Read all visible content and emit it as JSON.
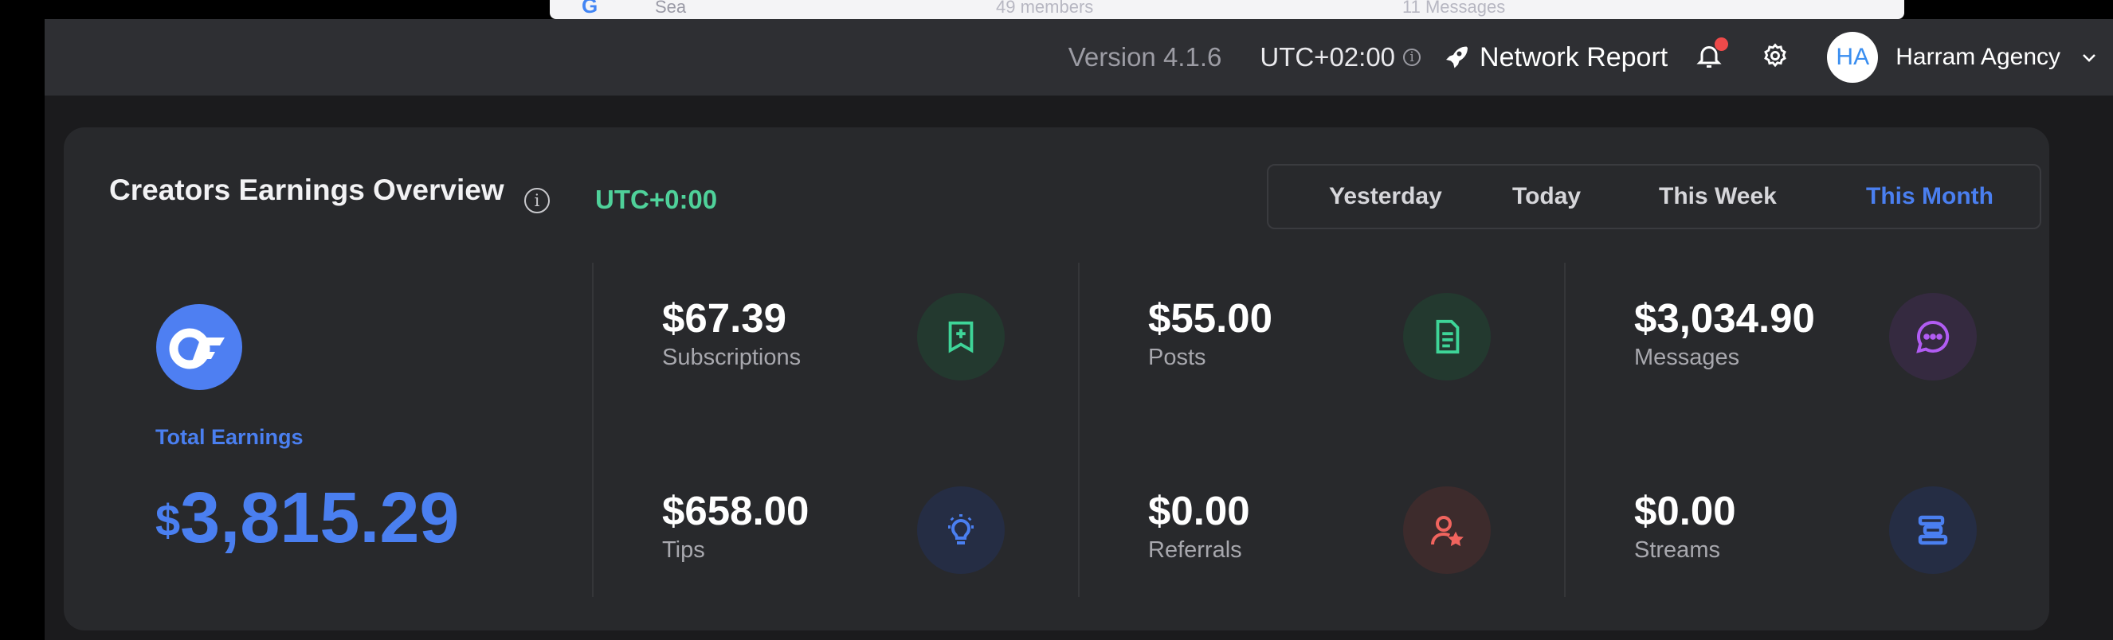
{
  "background_peek": {
    "search_text": "Sea",
    "members_text": "49 members",
    "messages_text": "11 Messages"
  },
  "header": {
    "version": "Version 4.1.6",
    "timezone": "UTC+02:00",
    "network_report": "Network Report",
    "avatar_initials": "HA",
    "agency_name": "Harram Agency"
  },
  "overview": {
    "title": "Creators Earnings Overview",
    "timezone": "UTC+0:00",
    "periods": [
      "Yesterday",
      "Today",
      "This Week",
      "This Month"
    ],
    "active_period": "This Month",
    "total_label": "Total Earnings",
    "total_currency": "$",
    "total_amount": "3,815.29",
    "stats": {
      "subscriptions": {
        "value": "$67.39",
        "label": "Subscriptions",
        "icon": "bookmark-plus-icon",
        "color": "#3ed598"
      },
      "posts": {
        "value": "$55.00",
        "label": "Posts",
        "icon": "document-icon",
        "color": "#3ed598"
      },
      "messages": {
        "value": "$3,034.90",
        "label": "Messages",
        "icon": "chat-bubble-icon",
        "color": "#b15cf3"
      },
      "tips": {
        "value": "$658.00",
        "label": "Tips",
        "icon": "lightbulb-icon",
        "color": "#4a7ff0"
      },
      "referrals": {
        "value": "$0.00",
        "label": "Referrals",
        "icon": "user-star-icon",
        "color": "#f0645e"
      },
      "streams": {
        "value": "$0.00",
        "label": "Streams",
        "icon": "stream-bars-icon",
        "color": "#4a7ff0"
      }
    }
  },
  "colors": {
    "accent": "#4a7ff0",
    "timezone_green": "#4fd19a",
    "notification_dot": "#ef4a4a"
  }
}
